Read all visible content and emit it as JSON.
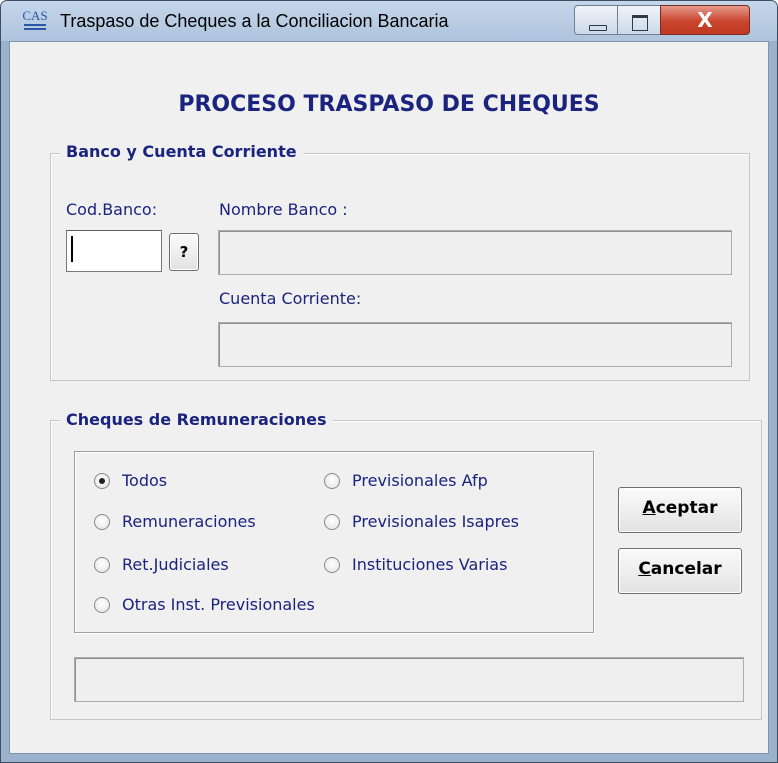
{
  "window": {
    "icon_text": "CAS",
    "title": "Traspaso de Cheques a la Conciliacion Bancaria",
    "close_glyph": "X"
  },
  "form": {
    "heading": "PROCESO TRASPASO DE CHEQUES"
  },
  "bank_group": {
    "legend": "Banco y Cuenta Corriente",
    "cod_banco_label": "Cod.Banco:",
    "cod_banco_value": "",
    "lookup_label": "?",
    "nombre_banco_label": "Nombre Banco :",
    "nombre_banco_value": "",
    "cuenta_corriente_label": "Cuenta Corriente:",
    "cuenta_corriente_value": ""
  },
  "cheques_group": {
    "legend": "Cheques de Remuneraciones",
    "options": [
      {
        "label": "Todos",
        "checked": true
      },
      {
        "label": "Remuneraciones",
        "checked": false
      },
      {
        "label": "Ret.Judiciales",
        "checked": false
      },
      {
        "label": "Otras Inst. Previsionales",
        "checked": false
      },
      {
        "label": "Previsionales Afp",
        "checked": false
      },
      {
        "label": "Previsionales Isapres",
        "checked": false
      },
      {
        "label": "Instituciones Varias",
        "checked": false
      }
    ],
    "accept": {
      "mnemonic": "A",
      "rest": "ceptar"
    },
    "cancel": {
      "mnemonic": "C",
      "rest": "ancelar"
    },
    "status_text": ""
  }
}
